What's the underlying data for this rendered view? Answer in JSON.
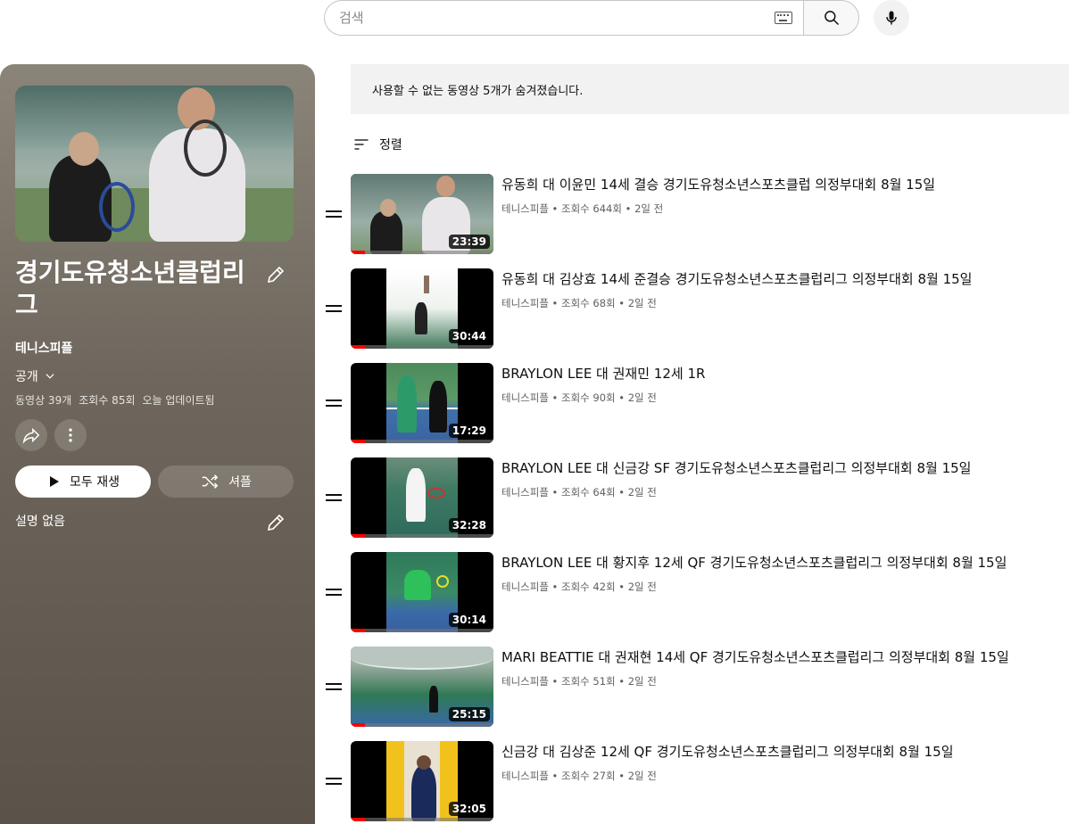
{
  "search": {
    "placeholder": "검색"
  },
  "playlist": {
    "title": "경기도유청소년클럽리그",
    "channel": "테니스피플",
    "privacy": "공개",
    "stats": [
      "동영상 39개",
      "조회수 85회",
      "오늘 업데이트됨"
    ],
    "play_all_label": "모두 재생",
    "shuffle_label": "셔플",
    "description": "설명 없음"
  },
  "notice": "사용할 수 없는 동영상 5개가 숨겨졌습니다.",
  "sort_label": "정렬",
  "videos": [
    {
      "title": "유동희 대 이윤민 14세 결승 경기도유청소년스포츠클럽 의정부대회 8월 15일",
      "channel": "테니스피플",
      "views": "조회수 644회",
      "age": "2일 전",
      "duration": "23:39"
    },
    {
      "title": "유동희 대 김상효 14세 준결승 경기도유청소년스포츠클럽리그 의정부대회 8월 15일",
      "channel": "테니스피플",
      "views": "조회수 68회",
      "age": "2일 전",
      "duration": "30:44"
    },
    {
      "title": "BRAYLON LEE 대 권재민 12세 1R",
      "channel": "테니스피플",
      "views": "조회수 90회",
      "age": "2일 전",
      "duration": "17:29"
    },
    {
      "title": "BRAYLON LEE 대 신금강 SF 경기도유청소년스포츠클럽리그 의정부대회 8월 15일",
      "channel": "테니스피플",
      "views": "조회수 64회",
      "age": "2일 전",
      "duration": "32:28"
    },
    {
      "title": "BRAYLON LEE 대 황지후 12세 QF 경기도유청소년스포츠클럽리그 의정부대회 8월 15일",
      "channel": "테니스피플",
      "views": "조회수 42회",
      "age": "2일 전",
      "duration": "30:14"
    },
    {
      "title": "MARI BEATTIE 대 권재현 14세 QF 경기도유청소년스포츠클럽리그 의정부대회 8월 15일",
      "channel": "테니스피플",
      "views": "조회수 51회",
      "age": "2일 전",
      "duration": "25:15"
    },
    {
      "title": "신금강 대 김상준 12세 QF 경기도유청소년스포츠클럽리그 의정부대회 8월 15일",
      "channel": "테니스피플",
      "views": "조회수 27회",
      "age": "2일 전",
      "duration": "32:05"
    }
  ],
  "colors": {
    "progress": "#ff0000",
    "panel": "#6f675d",
    "notice_bg": "#f2f2f2"
  }
}
